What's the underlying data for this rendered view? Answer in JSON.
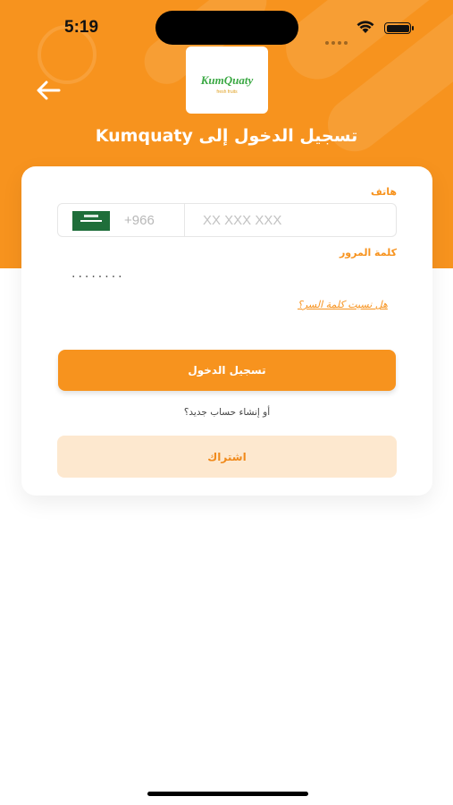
{
  "status_bar": {
    "time": "5:19"
  },
  "header": {
    "logo_text": "KumQuaty",
    "logo_sub": "fresh fruits",
    "title": "Kumquaty تسجيل الدخول إلى"
  },
  "form": {
    "phone_label": "هاتف",
    "country_code": "+966",
    "phone_placeholder": "XX XXX XXX",
    "password_label": "كلمة المرور",
    "password_value": "········",
    "forgot_password": "هل نسيت كلمة السر؟",
    "login_button": "تسجيل الدخول",
    "or_create": "أو إنشاء حساب جديد؟",
    "signup_button": "اشتراك"
  },
  "colors": {
    "accent": "#f7931e",
    "accent_light": "#fde8cf"
  }
}
